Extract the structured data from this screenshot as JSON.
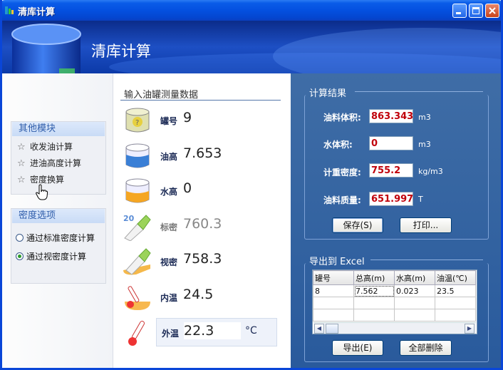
{
  "window": {
    "title": "清库计算"
  },
  "header": {
    "title": "清库计算"
  },
  "other_modules": {
    "title": "其他模块",
    "items": [
      "收发油计算",
      "进油高度计算",
      "密度换算"
    ]
  },
  "density_options": {
    "title": "密度选项",
    "options": [
      "通过标准密度计算",
      "通过视密度计算"
    ],
    "selected": "通过视密度计算"
  },
  "input": {
    "title": "输入油罐测量数据",
    "rows": [
      {
        "label": "罐号",
        "value": "9"
      },
      {
        "label": "油高",
        "value": "7.653"
      },
      {
        "label": "水高",
        "value": "0"
      },
      {
        "label": "标密",
        "value": "760.3"
      },
      {
        "label": "视密",
        "value": "758.3"
      },
      {
        "label": "内温",
        "value": "24.5"
      },
      {
        "label": "外温",
        "value": "22.3",
        "unit": "°C"
      }
    ]
  },
  "result": {
    "title": "计算结果",
    "fields": [
      {
        "label": "油料体积:",
        "value": "863.343",
        "unit": "m3"
      },
      {
        "label": "水体积:",
        "value": "0",
        "unit": "m3"
      },
      {
        "label": "计重密度:",
        "value": "755.2",
        "unit": "kg/m3"
      },
      {
        "label": "油料质量:",
        "value": "651.997",
        "unit": "T"
      }
    ],
    "save_label": "保存(S)",
    "print_label": "打印..."
  },
  "export": {
    "title": "导出到 Excel",
    "columns": [
      "罐号",
      "总高(m)",
      "水高(m)",
      "油温(℃)"
    ],
    "rows": [
      [
        "8",
        "7.562",
        "0.023",
        "23.5"
      ]
    ],
    "export_label": "导出(E)",
    "delete_label": "全部删除"
  },
  "colors": {
    "accent": "#295a9c",
    "title_bar": "#0a5ce8",
    "result_value": "#c0000b"
  }
}
